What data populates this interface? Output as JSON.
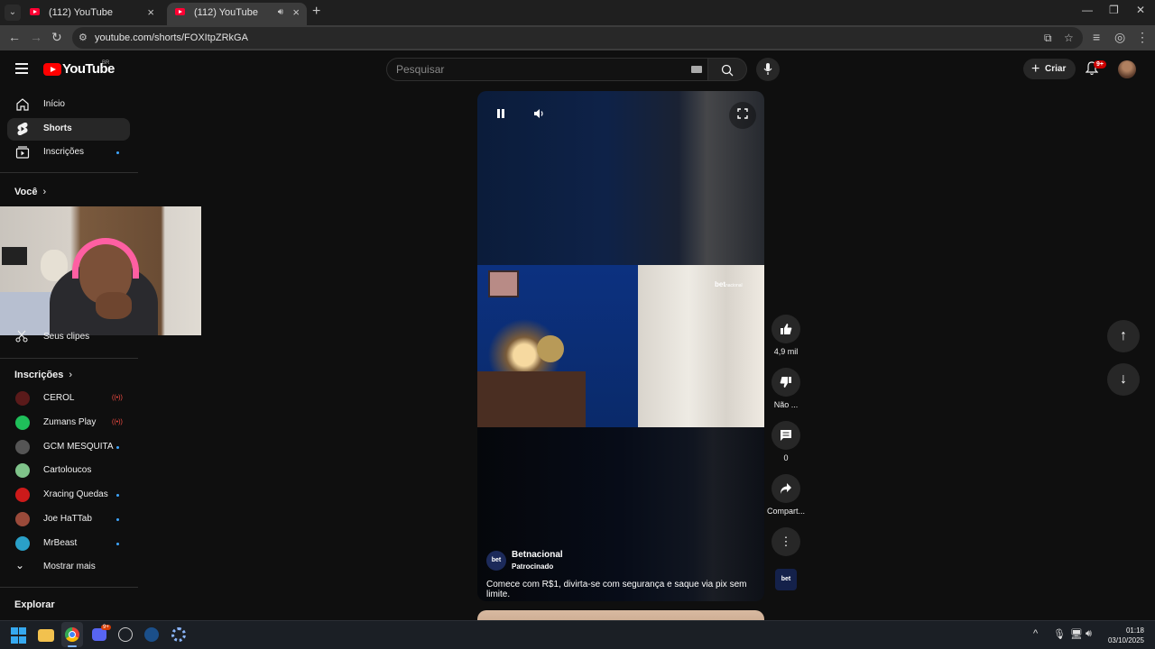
{
  "browser": {
    "tabs": [
      {
        "title": "(112) YouTube",
        "active": false
      },
      {
        "title": "(112) YouTube",
        "active": true
      }
    ],
    "url": "youtube.com/shorts/FOXItpZRkGA"
  },
  "masthead": {
    "logo_text": "YouTube",
    "country_code": "BR",
    "search_placeholder": "Pesquisar",
    "create_label": "Criar",
    "notifications_badge": "9+"
  },
  "sidebar": {
    "main": [
      {
        "label": "Início",
        "icon": "home-icon"
      },
      {
        "label": "Shorts",
        "icon": "shorts-icon",
        "active": true
      },
      {
        "label": "Inscrições",
        "icon": "subscriptions-icon",
        "dot": true
      }
    ],
    "you_heading": "Você",
    "clips_label": "Seus clipes",
    "subs_heading": "Inscrições",
    "channels": [
      {
        "name": "CEROL",
        "status": "live",
        "color": "#5a1a1a"
      },
      {
        "name": "Zumans Play",
        "status": "live",
        "color": "#1fbf5a"
      },
      {
        "name": "GCM MESQUITA",
        "status": "dot",
        "color": "#555555"
      },
      {
        "name": "Cartoloucos",
        "status": "",
        "color": "#7fc38a"
      },
      {
        "name": "Xracing Quedas",
        "status": "dot",
        "color": "#cc1a1a"
      },
      {
        "name": "Joe HaTTab",
        "status": "dot",
        "color": "#9a4a3a"
      },
      {
        "name": "MrBeast",
        "status": "dot",
        "color": "#2aa0c8"
      }
    ],
    "show_more": "Mostrar mais",
    "explore_heading": "Explorar"
  },
  "short": {
    "watermark": "bet",
    "watermark_suffix": "nacional",
    "channel": "Betnacional",
    "sponsored": "Patrocinado",
    "description": "Comece com R$1, divirta-se com segurança e saque via pix sem limite.",
    "avatar_text": "bet"
  },
  "actions": {
    "likes": "4,9 mil",
    "dislike": "Não ...",
    "comments": "0",
    "share": "Compart..."
  },
  "taskbar": {
    "discord_badge": "9+",
    "time": "01:18",
    "date": "03/10/2025"
  },
  "colors": {
    "accent_red": "#ff0000",
    "active_bg": "#272727",
    "link_blue": "#3ea6ff"
  }
}
